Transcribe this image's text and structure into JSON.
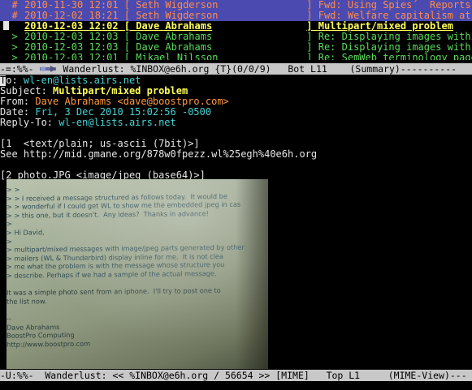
{
  "summary": {
    "rows": [
      {
        "mark": "  #",
        "date": "2010-11-30 12:01",
        "bracket": " [ ",
        "from": "Seth Wigderson",
        "close": "] ",
        "subject": "Fwd: Using Spies´  Reports as"
      },
      {
        "mark": "  #",
        "date": "2010-12-02 18:21",
        "bracket": " [ ",
        "from": "Seth Wigderson",
        "close": "] ",
        "subject": "Fwd: Welfare capitalism at End"
      },
      {
        "mark": "",
        "date": "2010-12-03 12:02",
        "bracket": " [ ",
        "from": "Dave Abrahams",
        "close": "] ",
        "subject": "Multipart/mixed problem"
      },
      {
        "mark": "  >",
        "date": "2010-12-03 12:03",
        "bracket": " [ ",
        "from": "Dave Abrahams",
        "close": "] ",
        "subject": "Re: Displaying images within m"
      },
      {
        "mark": "  >",
        "date": "2010-12-03 12:03",
        "bracket": " [ ",
        "from": "Dave Abrahams",
        "close": "] ",
        "subject": "Re: Displaying images within m"
      },
      {
        "mark": "  >",
        "date": "2010-12-03 12:01",
        "bracket": " [ ",
        "from": "Mikael Nilsson",
        "close": "] ",
        "subject": "Re: SemWeb terminology page"
      }
    ]
  },
  "modeline_top": {
    "left": "-=:%%- ",
    "text": " Wanderlust: %INBOX@e6h.org {T}(0/0/9)   Bot L11    (Summary)----------"
  },
  "headers": {
    "to_label": "o: ",
    "to_first": "T",
    "to_value": "wl-en@lists.airs.net",
    "subject_label": "Subject: ",
    "subject_value": "Multipart/mixed problem",
    "from_label": "From: ",
    "from_value": "Dave Abrahams <dave@boostpro.com>",
    "date_label": "Date: ",
    "date_value": "Fri, 3 Dec 2010 15:02:56 -0500",
    "replyto_label": "Reply-To: ",
    "replyto_value": "wl-en@lists.airs.net"
  },
  "parts": {
    "part1": "[1  <text/plain; us-ascii (7bit)>]",
    "see_line": "See http://mid.gmane.org/878w0fpezz.wl%25egh%40e6h.org",
    "part2": "[2 photo.JPG <image/jpeg (base64)>]"
  },
  "photo_text": [
    "> >",
    "> > I received a message structured as follows today.  It would be",
    "> > wonderful if I could get WL to show me the embedded jpeg in cas",
    "> > this one, but it doesn't.  Any ideas?  Thanks in advance!",
    ">",
    "> Hi David,",
    ">",
    "> multipart/mixed messages with image/jpeg parts generated by other",
    "> mailers (WL & Thunderbird) display inline for me.  It is not clea",
    "> me what the problem is with the message whose structure you",
    "> describe. Perhaps if we had a sample of the actual message.",
    "",
    "It was a simple photo sent from an iphone.  I'll try to post one to",
    "the list now.",
    "",
    "--",
    "Dave Abrahams",
    "BoostPro Computing",
    "http://www.boostpro.com"
  ],
  "modeline_bottom": {
    "text": "-U:%%-  Wanderlust: << %INBOX@e6h.org / 56654 >> [MIME]   Top L1     (MIME-View)---"
  },
  "colors": {
    "background": "#000000",
    "selected_row_bg": "#4a4ab0",
    "selected_row_fg": "#ff8c4a",
    "current_row_fg": "#ffff5a",
    "reply_row_fg": "#5adc5a",
    "cyan": "#46d2d2",
    "orange": "#ff9a3c",
    "modeline_bg": "#c8c8c8"
  }
}
